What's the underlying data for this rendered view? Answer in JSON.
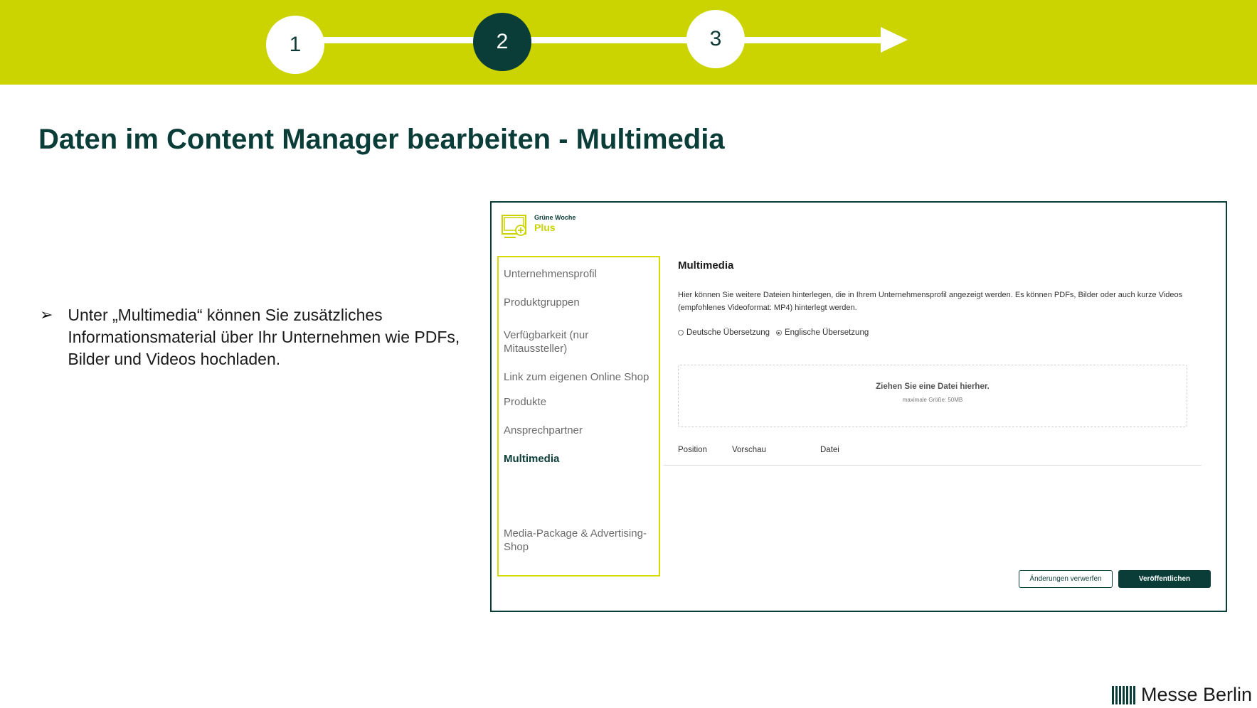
{
  "steps": [
    {
      "label": "1",
      "active": false
    },
    {
      "label": "2",
      "active": true
    },
    {
      "label": "3",
      "active": false
    }
  ],
  "slide": {
    "title": "Daten im Content Manager bearbeiten - Multimedia",
    "bullet_marker": "➢",
    "bullet_text": "Unter „Multimedia“ können Sie zusätzliches Informationsmaterial über Ihr Unternehmen wie PDFs, Bilder und Videos  hochladen."
  },
  "app": {
    "logo_top": "Grüne Woche",
    "logo_bottom": "Plus",
    "sidebar": [
      {
        "label": "Unternehmensprofil",
        "active": false
      },
      {
        "label": "Produktgruppen",
        "active": false
      },
      {
        "label": "Verfügbarkeit (nur Mitaussteller)",
        "active": false
      },
      {
        "label": "Link zum eigenen Online Shop",
        "active": false
      },
      {
        "label": "Produkte",
        "active": false
      },
      {
        "label": "Ansprechpartner",
        "active": false
      },
      {
        "label": "Multimedia",
        "active": true
      },
      {
        "label": "Media-Package & Advertising-Shop",
        "active": false
      }
    ],
    "content": {
      "title": "Multimedia",
      "description": "Hier können Sie weitere Dateien hinterlegen, die in Ihrem Unternehmensprofil angezeigt werden. Es können PDFs, Bilder oder auch kurze Videos (empfohlenes Videoformat: MP4) hinterlegt werden.",
      "radio_de": "Deutsche Übersetzung",
      "radio_en": "Englische Übersetzung",
      "selected_language": "en",
      "dropzone_title": "Ziehen Sie eine Datei hierher.",
      "dropzone_sub": "maximale Größe: 50MB",
      "columns": [
        "Position",
        "Vorschau",
        "Datei"
      ],
      "btn_discard": "Änderungen verwerfen",
      "btn_publish": "Veröffentlichen"
    }
  },
  "footer": {
    "brand": "Messe Berlin"
  },
  "colors": {
    "accent": "#cbd400",
    "brand_dark": "#0b3d38"
  }
}
